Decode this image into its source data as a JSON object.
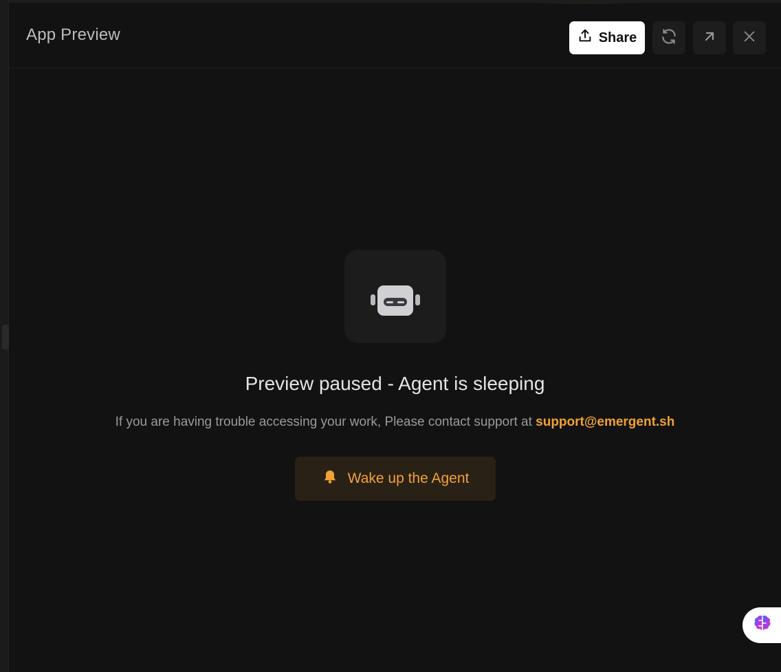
{
  "header": {
    "title": "App Preview",
    "share_label": "Share",
    "share_icon": "upload-icon",
    "refresh_icon": "refresh-icon",
    "open_icon": "arrow-up-right-icon",
    "close_icon": "close-icon"
  },
  "main": {
    "robot_icon": "robot-icon",
    "headline": "Preview paused - Agent is sleeping",
    "support_text": "If you are having trouble accessing your work, Please contact support at",
    "support_email": "support@emergent.sh",
    "wake_label": "Wake up the Agent",
    "wake_icon": "bell-icon"
  },
  "fab": {
    "icon": "brain-icon"
  },
  "colors": {
    "background": "#121212",
    "accent": "#f0a236",
    "button_dark": "#1d1d1d",
    "wake_button_bg": "#2a2116"
  }
}
